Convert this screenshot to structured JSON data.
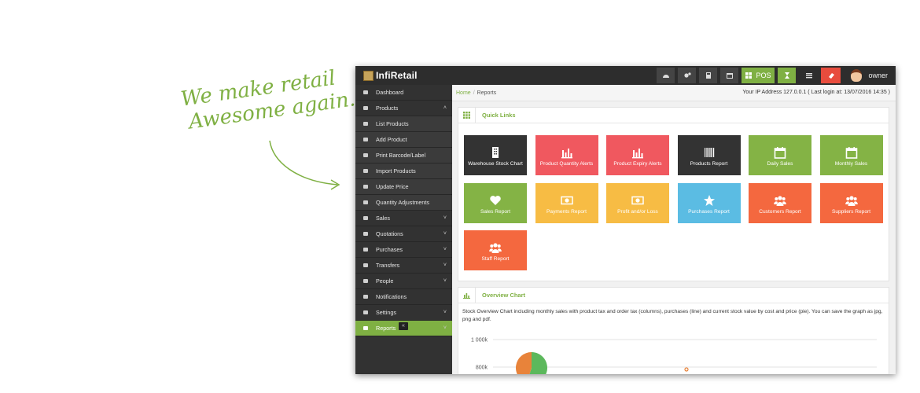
{
  "tagline": {
    "line1": "We make retail",
    "line2": "Awesome again."
  },
  "topbar": {
    "logo": "InfiRetail",
    "pos_label": "POS",
    "user_name": "owner",
    "icons": [
      "dashboard-icon",
      "cogs-icon",
      "calculator-icon",
      "calendar-icon",
      "pos-grid-icon",
      "hourglass-icon",
      "list-icon",
      "eraser-icon"
    ]
  },
  "sidebar": {
    "items": [
      {
        "label": "Dashboard",
        "icon": "dashboard-icon"
      },
      {
        "label": "Products",
        "icon": "barcode-icon",
        "caret": "^"
      },
      {
        "label": "List Products",
        "icon": "barcode-icon",
        "sub": true
      },
      {
        "label": "Add Product",
        "icon": "plus-circle-icon",
        "sub": true
      },
      {
        "label": "Print Barcode/Label",
        "icon": "tag-icon",
        "sub": true
      },
      {
        "label": "Import Products",
        "icon": "file-icon",
        "sub": true
      },
      {
        "label": "Update Price",
        "icon": "money-icon",
        "sub": true
      },
      {
        "label": "Quantity Adjustments",
        "icon": "filter-icon",
        "sub": true
      },
      {
        "label": "Sales",
        "icon": "heart-icon",
        "caret": "v"
      },
      {
        "label": "Quotations",
        "icon": "heart-outline-icon",
        "caret": "v"
      },
      {
        "label": "Purchases",
        "icon": "star-icon",
        "caret": "v"
      },
      {
        "label": "Transfers",
        "icon": "star-outline-icon",
        "caret": "v"
      },
      {
        "label": "People",
        "icon": "users-icon",
        "caret": "v"
      },
      {
        "label": "Notifications",
        "icon": "info-icon"
      },
      {
        "label": "Settings",
        "icon": "cog-icon",
        "caret": "v"
      },
      {
        "label": "Reports",
        "icon": "bar-chart-icon",
        "caret": "v",
        "active": true
      }
    ],
    "collapse_glyph": "«"
  },
  "breadcrumb": {
    "home": "Home",
    "sep": "/",
    "current": "Reports"
  },
  "ip_info": "Your IP Address 127.0.0.1 ( Last login at: 13/07/2016 14:35 )",
  "quick_links": {
    "title": "Quick Links",
    "tiles": [
      {
        "label": "Warehouse Stock Chart",
        "color": "#333333",
        "icon": "building-icon"
      },
      {
        "label": "Product Quantity Alerts",
        "color": "#f0585f",
        "icon": "bar-chart-icon"
      },
      {
        "label": "Product Expiry Alerts",
        "color": "#f0585f",
        "icon": "bar-chart-icon"
      },
      {
        "label": "Products Report",
        "color": "#333333",
        "icon": "barcode-icon"
      },
      {
        "label": "Daily Sales",
        "color": "#84b345",
        "icon": "calendar-icon"
      },
      {
        "label": "Monthly Sales",
        "color": "#84b345",
        "icon": "calendar-icon"
      },
      {
        "label": "Sales Report",
        "color": "#84b345",
        "icon": "heart-icon"
      },
      {
        "label": "Payments Report",
        "color": "#f7bc44",
        "icon": "money-icon"
      },
      {
        "label": "Profit and/or Loss",
        "color": "#f7bc44",
        "icon": "money-icon"
      },
      {
        "label": "Purchases Report",
        "color": "#5bbce3",
        "icon": "star-icon"
      },
      {
        "label": "Customers Report",
        "color": "#f4683f",
        "icon": "users-icon"
      },
      {
        "label": "Suppliers Report",
        "color": "#f4683f",
        "icon": "users-icon"
      },
      {
        "label": "Staff Report",
        "color": "#f4683f",
        "icon": "users-icon"
      }
    ]
  },
  "overview": {
    "title": "Overview Chart",
    "description": "Stock Overview Chart including monthly sales with product tax and order tax (columns), purchases (line) and current stock value by cost and price (pie). You can save the graph as jpg, png and pdf."
  },
  "chart_data": {
    "type": "bar",
    "title": "",
    "xlabel": "",
    "ylabel": "",
    "y_ticks": [
      "1 000k",
      "800k"
    ],
    "categories": [],
    "series": [],
    "pie": {
      "slices": [
        {
          "value": 55,
          "color": "#5cb85c"
        },
        {
          "value": 45,
          "color": "#e8833a"
        }
      ]
    },
    "line_points": [
      {
        "value": 800
      }
    ],
    "grid": true
  }
}
